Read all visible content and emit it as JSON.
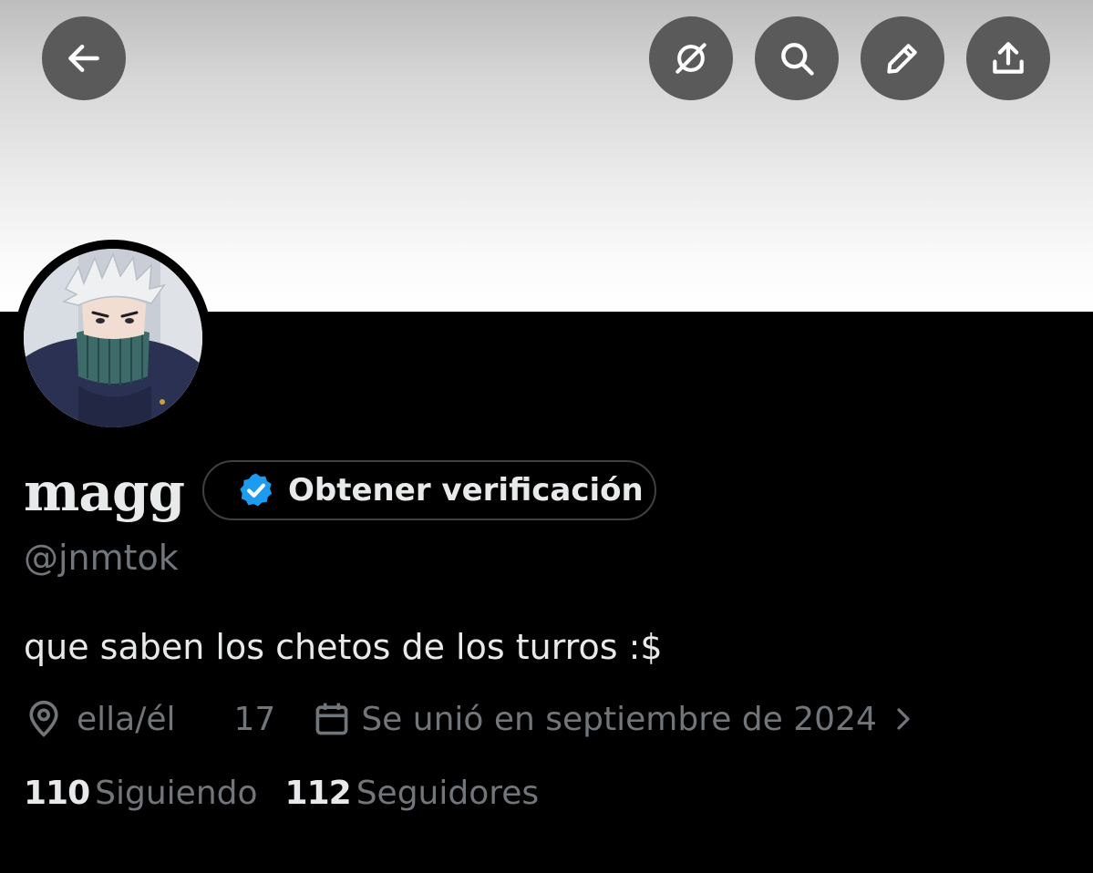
{
  "header": {
    "back_icon": "arrow-left-icon",
    "grok_icon": "grok-icon",
    "search_icon": "search-icon",
    "edit_icon": "pencil-icon",
    "share_icon": "share-upload-icon"
  },
  "profile": {
    "display_name": "magg",
    "handle": "@jnmtok",
    "bio": "que saben los chetos de los turros :$",
    "verify_button_label": "Obtener verificación",
    "verify_badge_color": "#1d9bf0",
    "pronouns": "ella/él",
    "age": "17",
    "joined": "Se unió en septiembre de 2024"
  },
  "stats": {
    "following_count": "110",
    "following_label": "Siguiendo",
    "followers_count": "112",
    "followers_label": "Seguidores"
  },
  "colors": {
    "background": "#000000",
    "primary_text": "#e7e9ea",
    "secondary_text": "#71767b",
    "button_bg": "#5a5a5a"
  }
}
